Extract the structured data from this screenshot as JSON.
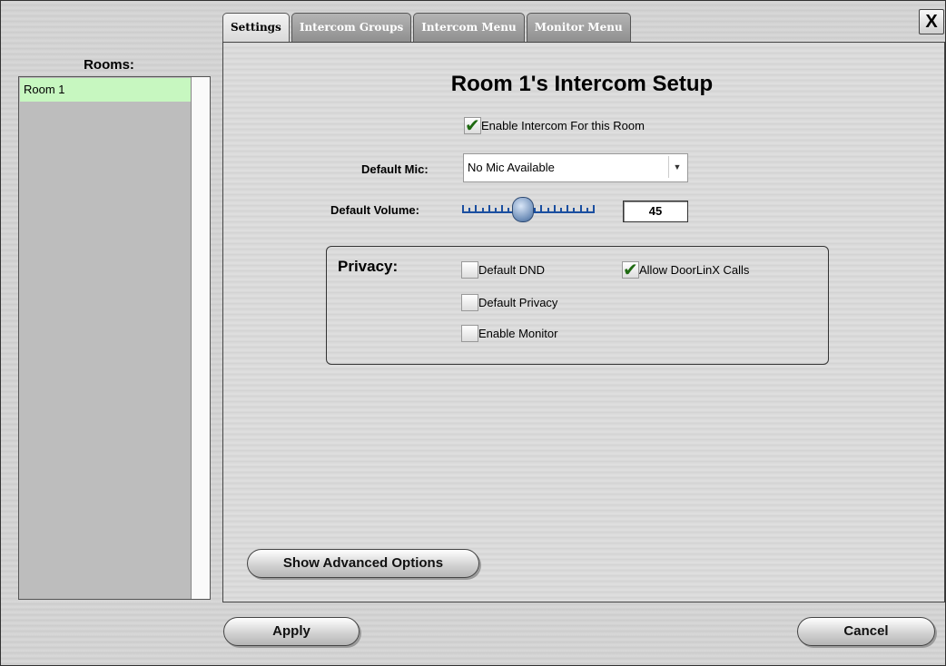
{
  "tabs": [
    "Settings",
    "Intercom Groups",
    "Intercom Menu",
    "Monitor Menu"
  ],
  "close_label": "X",
  "rooms": {
    "title": "Rooms:",
    "items": [
      "Room 1"
    ]
  },
  "setup": {
    "title": "Room 1's Intercom Setup",
    "enable_label": "Enable Intercom For this Room",
    "enable_checked": true,
    "mic_label": "Default Mic:",
    "mic_value": "No Mic Available",
    "volume_label": "Default Volume:",
    "volume_value": "45"
  },
  "privacy": {
    "title": "Privacy:",
    "options": [
      {
        "label": "Default DND",
        "checked": false
      },
      {
        "label": "Allow DoorLinX Calls",
        "checked": true
      },
      {
        "label": "Default Privacy",
        "checked": false
      },
      {
        "label": "Enable Monitor",
        "checked": false
      }
    ]
  },
  "buttons": {
    "advanced": "Show Advanced Options",
    "apply": "Apply",
    "cancel": "Cancel"
  }
}
